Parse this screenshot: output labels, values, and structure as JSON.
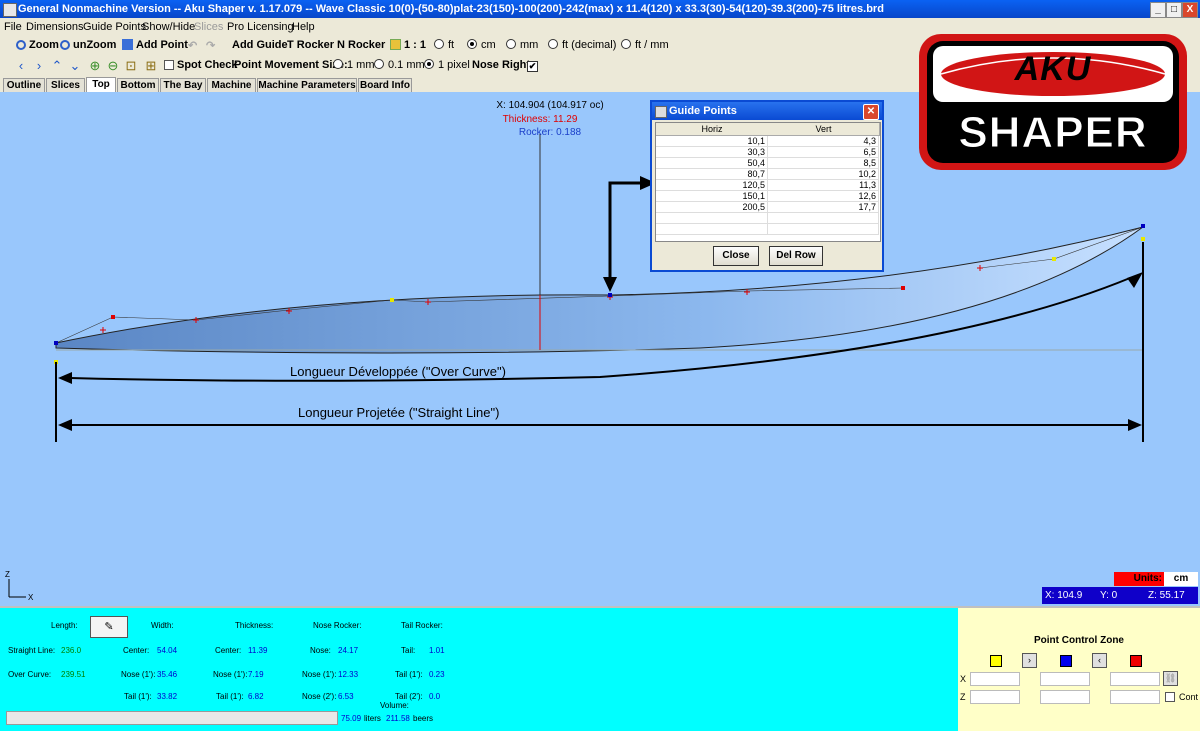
{
  "window": {
    "title": "General Nonmachine Version -- Aku Shaper v. 1.17.079  --  Wave Classic 10(0)-(50-80)plat-23(150)-100(200)-242(max) x 11.4(120) x 33.3(30)-54(120)-39.3(200)-75 litres.brd",
    "minimize": "_",
    "maximize": "□",
    "close": "X"
  },
  "menu": [
    "File",
    "Dimensions",
    "Guide Points",
    "Show/Hide",
    "Slices",
    "Pro Licensing",
    "Help"
  ],
  "toolbar1": {
    "zoom": "Zoom",
    "unzoom": "unZoom",
    "add_point": "Add Point",
    "add_guide": "Add Guide",
    "t_rocker": "T Rocker",
    "n_rocker": "N Rocker",
    "scale": "1 : 1",
    "unit_ft": "ft",
    "unit_cm": "cm",
    "unit_mm": "mm",
    "unit_ft_decimal": "ft (decimal)",
    "unit_ft_mm": "ft / mm"
  },
  "toolbar2": {
    "spot_check": "Spot Check",
    "point_movement_size": "Point Movement Size:",
    "move_1mm": "1 mm",
    "move_01mm": "0.1 mm",
    "move_1px": "1 pixel",
    "nose_right": "Nose Right:",
    "nose_right_check": "✔"
  },
  "tabs": [
    "Outline",
    "Slices",
    "Top",
    "Bottom",
    "The Bay",
    "Machine",
    "Machine Parameters",
    "Board Info"
  ],
  "active_tab": "Top",
  "cursor_readout": {
    "x": "X: 104.904 (104.917 oc)",
    "thickness": "Thickness: 11.29",
    "rocker": "Rocker: 0.188"
  },
  "annotations": {
    "over_curve": "Longueur Développée (\"Over Curve\")",
    "straight_line": "Longueur Projetée (\"Straight Line\")"
  },
  "axes": {
    "z": "Z",
    "x": "X"
  },
  "logo": {
    "top": "AKU",
    "bottom": "SHAPER"
  },
  "guide_points": {
    "title": "Guide Points",
    "columns": [
      "Horiz",
      "Vert"
    ],
    "rows": [
      [
        "10,1",
        "4,3"
      ],
      [
        "30,3",
        "6,5"
      ],
      [
        "50,4",
        "8,5"
      ],
      [
        "80,7",
        "10,2"
      ],
      [
        "120,5",
        "11,3"
      ],
      [
        "150,1",
        "12,6"
      ],
      [
        "200,5",
        "17,7"
      ]
    ],
    "close_button": "Close",
    "del_row_button": "Del Row"
  },
  "units": {
    "label": "Units:",
    "value": "cm"
  },
  "coords": {
    "x": "X: 104.9",
    "y": "Y: 0",
    "z": "Z: 55.17"
  },
  "board_info": {
    "length_label": "Length:",
    "width_label": "Width:",
    "thickness_label": "Thickness:",
    "nose_rocker_label": "Nose Rocker:",
    "tail_rocker_label": "Tail Rocker:",
    "straight_line_label": "Straight Line:",
    "straight_line_value": "236.0",
    "over_curve_label": "Over Curve:",
    "over_curve_value": "239.51",
    "width_center_label": "Center:",
    "width_center_value": "54.04",
    "width_nose_label": "Nose (1'):",
    "width_nose_value": "35.46",
    "width_tail_label": "Tail (1'):",
    "width_tail_value": "33.82",
    "thick_center_label": "Center:",
    "thick_center_value": "11.39",
    "thick_nose_label": "Nose (1'):",
    "thick_nose_value": "7.19",
    "thick_tail_label": "Tail (1'):",
    "thick_tail_value": "6.82",
    "nose_label": "Nose:",
    "nose_value": "24.17",
    "nose1_label": "Nose (1'):",
    "nose1_value": "12.33",
    "nose2_label": "Nose (2'):",
    "nose2_value": "6.53",
    "tail_label": "Tail:",
    "tail_value": "1.01",
    "tail1_label": "Tail (1'):",
    "tail1_value": "0.23",
    "tail2_label": "Tail (2'):",
    "tail2_value": "0.0",
    "volume_label": "Volume:",
    "volume_liters": "75.09",
    "liters_label": "liters",
    "volume_beers": "211.58",
    "beers_label": "beers"
  },
  "point_control": {
    "title": "Point Control Zone",
    "x_label": "X",
    "z_label": "Z",
    "cont_label": "Cont"
  }
}
